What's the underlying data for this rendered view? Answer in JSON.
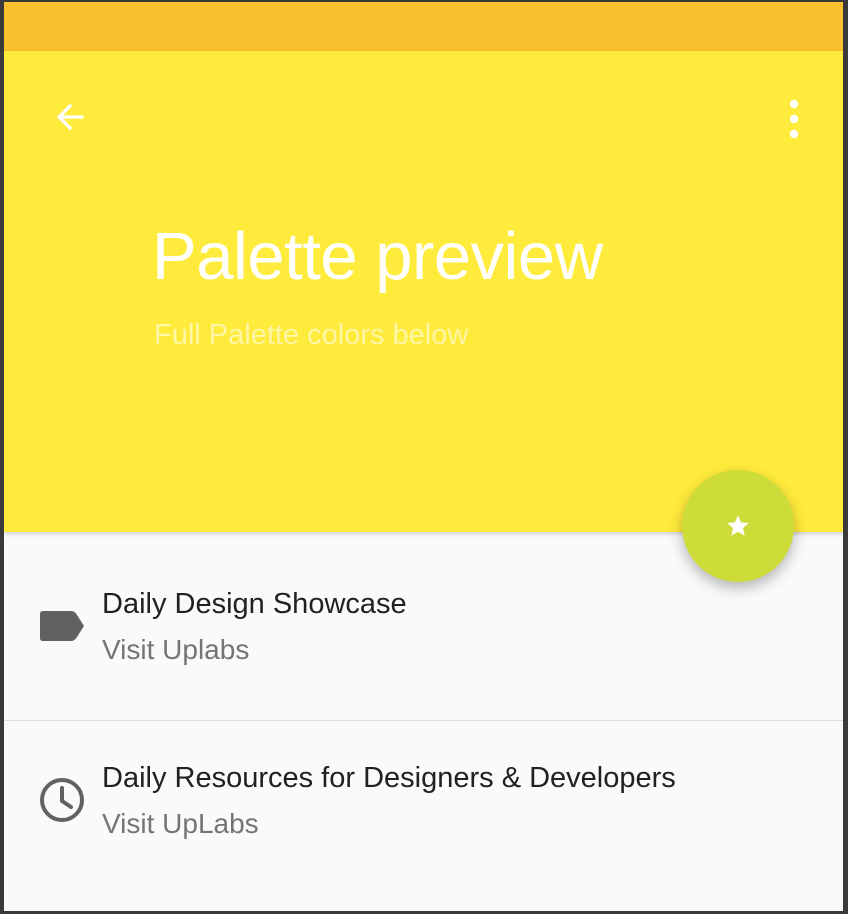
{
  "colors": {
    "status_bar": "#fbc02d",
    "app_bar": "#ffeb3b",
    "fab": "#cddc39",
    "list_background": "#fafafa"
  },
  "header": {
    "title": "Palette preview",
    "subtitle": "Full Palette colors below",
    "back_icon": "arrow-back-icon",
    "menu_icon": "more-vert-icon"
  },
  "fab": {
    "icon": "star-icon"
  },
  "list": {
    "items": [
      {
        "title": "Daily Design Showcase",
        "subtitle": "Visit Uplabs",
        "icon": "label-icon"
      },
      {
        "title": "Daily Resources for Designers & Developers",
        "subtitle": "Visit UpLabs",
        "icon": "clock-icon"
      }
    ]
  }
}
